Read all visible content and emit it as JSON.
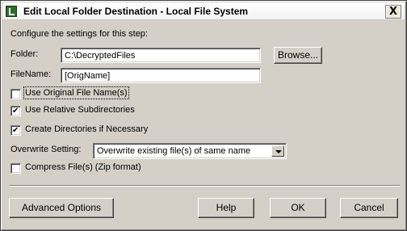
{
  "window": {
    "title": "Edit Local Folder Destination - Local File System",
    "close_label": "X"
  },
  "form": {
    "instruction": "Configure the settings for this step:",
    "folder_label": "Folder:",
    "folder_value": "C:\\DecryptedFiles",
    "browse_label": "Browse...",
    "filename_label": "FileName:",
    "filename_value": "[OrigName]",
    "use_original_name_label": "Use Original File Name(s)",
    "use_original_name_checked": false,
    "use_relative_subdirs_label": "Use Relative Subdirectories",
    "use_relative_subdirs_checked": true,
    "create_dirs_label": "Create Directories if Necessary",
    "create_dirs_checked": true,
    "overwrite_label": "Overwrite Setting:",
    "overwrite_value": "Overwrite existing file(s) of same name",
    "compress_label": "Compress File(s) (Zip format)",
    "compress_checked": false
  },
  "buttons": {
    "advanced_label": "Advanced Options",
    "help_label": "Help",
    "ok_label": "OK",
    "cancel_label": "Cancel"
  },
  "icons": {
    "app_icon": "app-icon"
  }
}
